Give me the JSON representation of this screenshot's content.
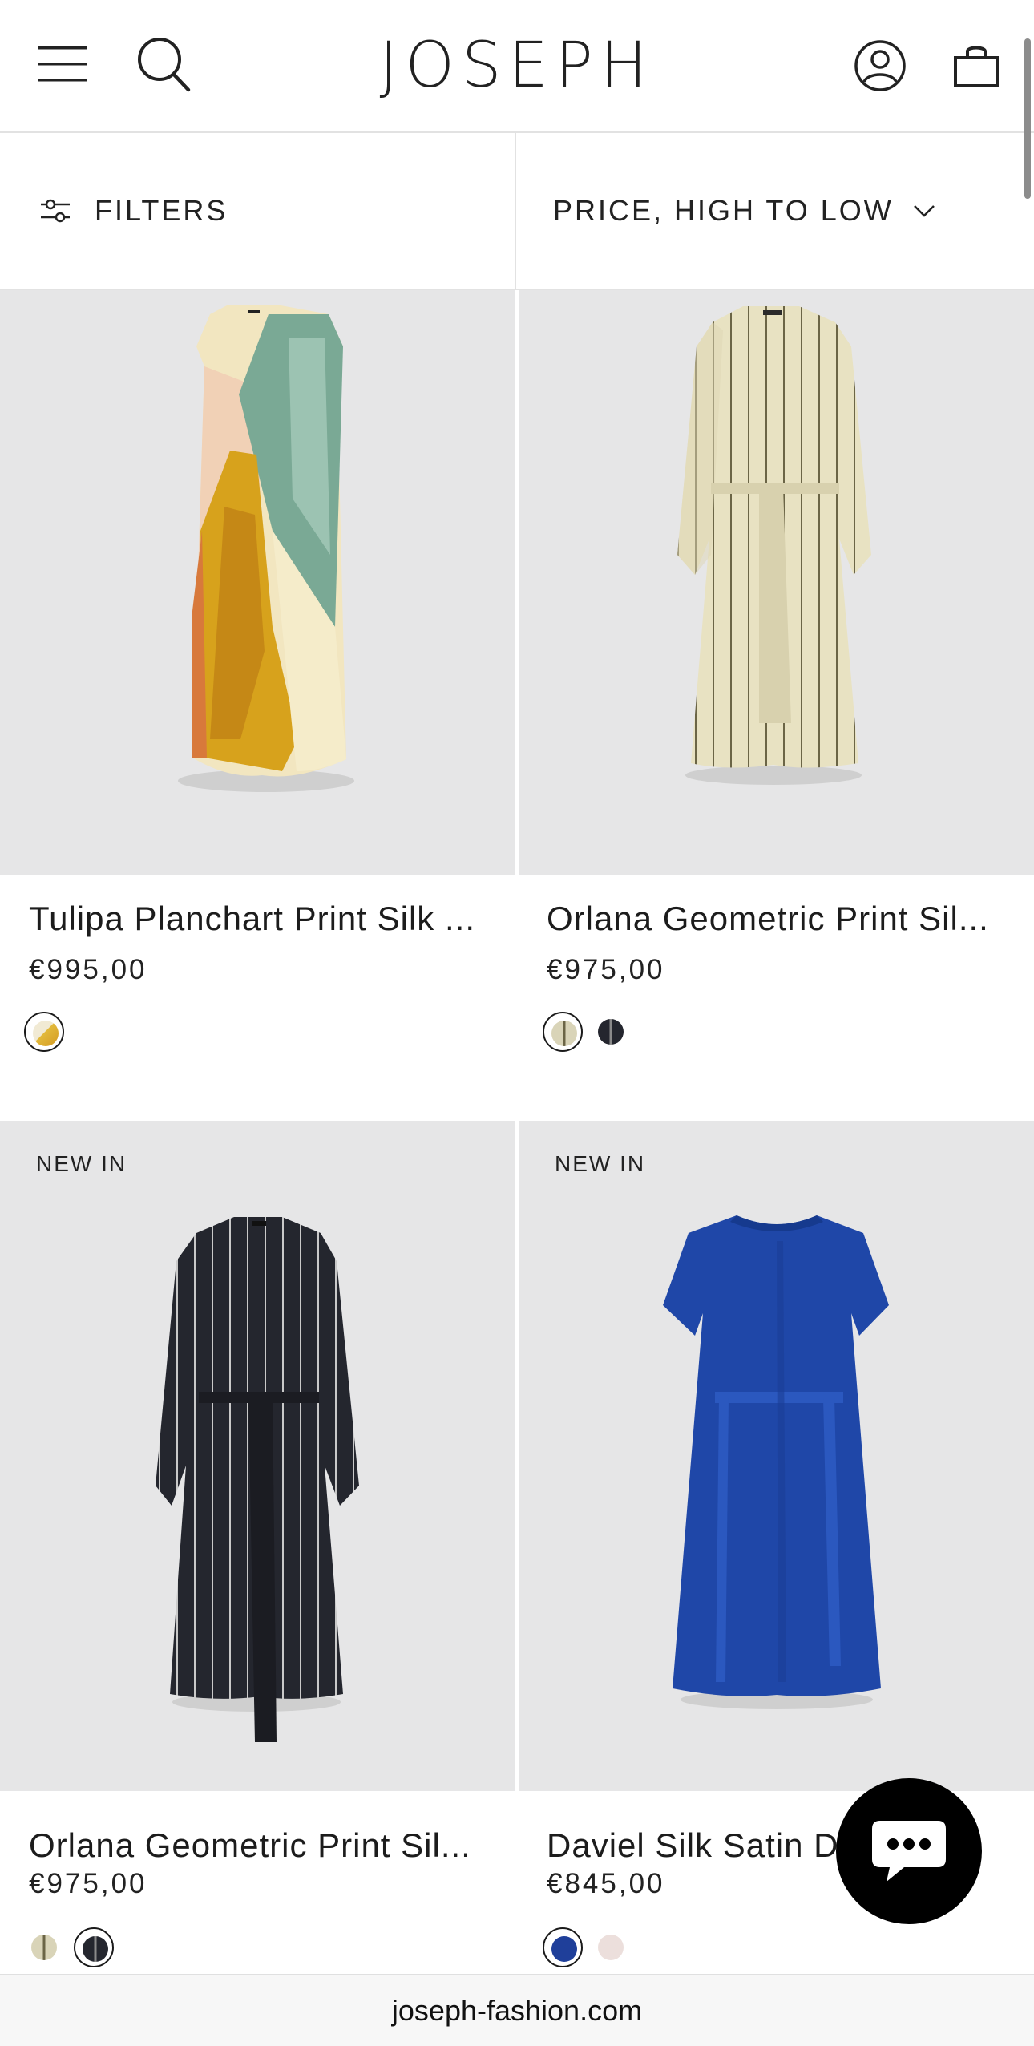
{
  "header": {
    "logo": "JOSEPH",
    "menu_icon": "hamburger-menu-icon",
    "search_icon": "search-icon",
    "account_icon": "account-icon",
    "cart_icon": "shopping-bag-icon"
  },
  "toolbar": {
    "filters_label": "FILTERS",
    "sort_label": "PRICE, HIGH TO LOW"
  },
  "products": [
    {
      "name": "Tulipa Planchart Print Silk ...",
      "price": "€995,00",
      "badge": "",
      "swatches": [
        {
          "color": "#e8c24a",
          "selected": true
        }
      ]
    },
    {
      "name": "Orlana Geometric Print Sil...",
      "price": "€975,00",
      "badge": "",
      "swatches": [
        {
          "color": "#d9d4b8",
          "selected": true
        },
        {
          "color": "#24262e",
          "selected": false
        }
      ]
    },
    {
      "name": "Orlana Geometric Print Sil...",
      "price": "€975,00",
      "badge": "NEW IN",
      "swatches": [
        {
          "color": "#d9d4b8",
          "selected": false
        },
        {
          "color": "#24262e",
          "selected": true
        }
      ]
    },
    {
      "name": "Daviel Silk Satin D",
      "price": "€845,00",
      "badge": "NEW IN",
      "swatches": [
        {
          "color": "#1f3f9a",
          "selected": true
        },
        {
          "color": "#ecdfdc",
          "selected": false
        }
      ]
    }
  ],
  "chat_icon": "chat-bubble-icon",
  "url": "joseph-fashion.com"
}
